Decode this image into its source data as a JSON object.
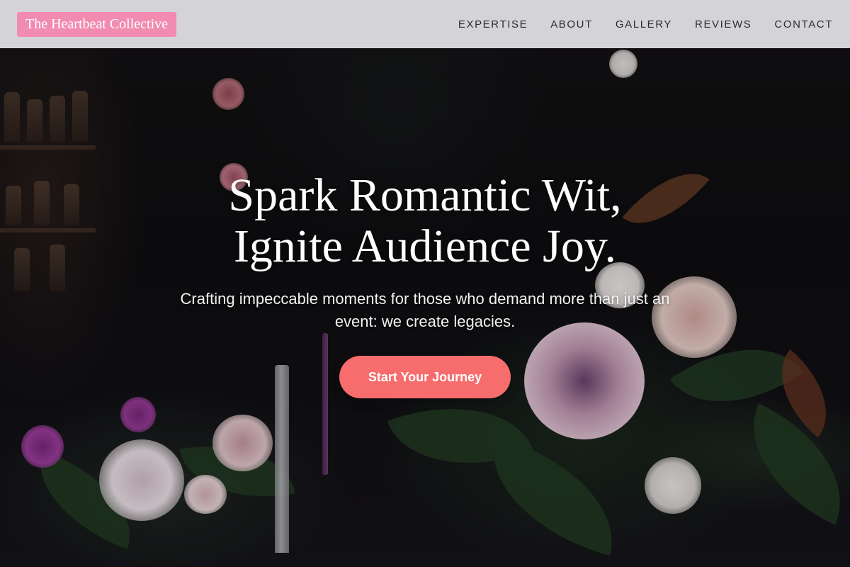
{
  "brand": {
    "name": "The Heartbeat Collective",
    "bg_color": "#f28bb0"
  },
  "nav": {
    "bg_color": "#d4d4d6",
    "items": [
      {
        "label": "EXPERTISE"
      },
      {
        "label": "ABOUT"
      },
      {
        "label": "GALLERY"
      },
      {
        "label": "REVIEWS"
      },
      {
        "label": "CONTACT"
      }
    ]
  },
  "hero": {
    "headline_line1": "Spark Romantic Wit,",
    "headline_line2": "Ignite Audience Joy.",
    "subheadline": "Crafting impeccable moments for those who demand more than just an event: we create legacies.",
    "cta_label": "Start Your Journey",
    "cta_color": "#f76c6c"
  }
}
